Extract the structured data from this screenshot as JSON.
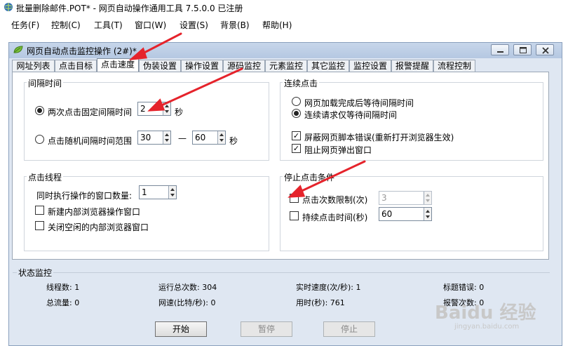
{
  "app": {
    "title": "批量删除邮件.POT* - 网页自动操作通用工具 7.5.0.0  已注册"
  },
  "menu": [
    "任务(F)",
    "控制(C)",
    "工具(T)",
    "窗口(W)",
    "设置(S)",
    "背景(B)",
    "帮助(H)"
  ],
  "window": {
    "title": "网页自动点击监控操作  (2#)*"
  },
  "tabs": [
    "网址列表",
    "点击目标",
    "点击速度",
    "伪装设置",
    "操作设置",
    "源码监控",
    "元素监控",
    "其它监控",
    "监控设置",
    "报警提醒",
    "流程控制"
  ],
  "active_tab": "点击速度",
  "interval": {
    "group_label": "间隔时间",
    "fixed_label": "两次点击固定间隔时间",
    "fixed_value": "2",
    "fixed_unit": "秒",
    "random_label": "点击随机间隔时间范围",
    "random_min": "30",
    "dash": "—",
    "random_max": "60",
    "random_unit": "秒"
  },
  "continuous": {
    "group_label": "连续点击",
    "opt_page_loaded": "网页加载完成后等待间隔时间",
    "opt_request_wait": "连续请求仅等待间隔时间",
    "chk_block_script_errors": "屏蔽网页脚本错误(重新打开浏览器生效)",
    "chk_block_popups": "阻止网页弹出窗口"
  },
  "threads": {
    "group_label": "点击线程",
    "window_count_label": "同时执行操作的窗口数量:",
    "window_count_value": "1",
    "chk_new_internal_browser": "新建内部浏览器操作窗口",
    "chk_close_idle_browser": "关闭空闲的内部浏览器窗口"
  },
  "stop": {
    "group_label": "停止点击条件",
    "chk_click_limit": "点击次数限制(次)",
    "click_limit_value": "3",
    "chk_duration": "持续点击时间(秒)",
    "duration_value": "60"
  },
  "status": {
    "group_label": "状态监控",
    "threads": "线程数:  1",
    "total_runs": "运行总次数:  304",
    "speed": "实时速度(次/秒):  1",
    "title_errors": "标题错误:  0",
    "total_flow": "总流量:  0",
    "net_speed": "网速(比特/秒):  0",
    "elapsed": "用时(秒):  761",
    "alarm_count": "报警次数:  0"
  },
  "buttons": {
    "start": "开始",
    "pause": "暂停",
    "stop": "停止"
  },
  "watermark": {
    "brand": "Baidu 经验",
    "url": "jingyan.baidu.com"
  },
  "colors": {
    "annotation_arrow": "#e5232b",
    "window_frame": "#dfe7f2"
  }
}
